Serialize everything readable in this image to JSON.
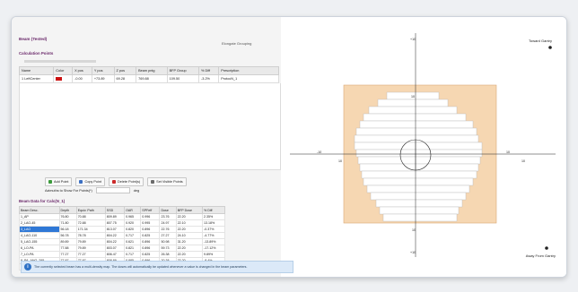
{
  "panel_title": "Beam (Tested)",
  "header_button": "Elongate Grouping",
  "calc_section": "Calculation Points",
  "points": {
    "columns": [
      "Name",
      "Color",
      "X pos",
      "Y pos",
      "Z pos",
      "Beam pntg",
      "BFP Group",
      "% Diff",
      "Prescription"
    ],
    "rows": [
      {
        "name": "1 LeftCenter",
        "color": "#cc1111",
        "x": "-0.00",
        "y": "+73.89",
        "z": "69.28",
        "beam": "769.88",
        "bfp": "109.50",
        "diff": "-3.2%",
        "prescription": "ProtocN_1"
      },
      {
        "name": "2 LeftPCA",
        "color": "#116611",
        "x": "0.73",
        "y": "+73.89",
        "z": "162.09",
        "beam": "769.78",
        "bfp": "108.60",
        "diff": "-2.9%",
        "prescription": "One for all prescriptions"
      }
    ]
  },
  "buttons": [
    "Add Point",
    "Copy Point",
    "Delete Point(s)",
    "Set Visible Points"
  ],
  "azimuth_label": "Azimuths to Show For Points(*)",
  "azimuth_unit": "deg",
  "beam_section": "Beam Data for Calc(N_1)",
  "beam": {
    "columns": [
      "Beam Desc.",
      "Depth",
      "Equiv. Path",
      "SSD",
      "OAR",
      "SPFeff",
      "Dose",
      "BFP Dose",
      "% Diff"
    ],
    "rows": [
      [
        "1_AP",
        "76.80",
        "70.88",
        "809.89",
        "0.965",
        "0.996",
        "23.76",
        "22.20",
        "2.35%"
      ],
      [
        "2_LAO-45",
        "71.80",
        "72.88",
        "807.75",
        "0.920",
        "0.995",
        "24.97",
        "22.10",
        "13.18%"
      ],
      [
        "3_LAO",
        "56.18",
        "171.34",
        "813.07",
        "0.820",
        "0.896",
        "22.76",
        "22.20",
        "-0.37%"
      ],
      [
        "4_LAO-110",
        "56.78",
        "78.78",
        "804.22",
        "0.717",
        "0.825",
        "27.27",
        "24.10",
        "-4.77%"
      ],
      [
        "5_LAO-155",
        "89.89",
        "79.89",
        "804.22",
        "0.621",
        "0.896",
        "50.98",
        "31.20",
        "-13.89%"
      ],
      [
        "6_LO-PA",
        "77.88",
        "79.89",
        "803.07",
        "0.821",
        "0.896",
        "59.73",
        "22.20",
        "-17.12%"
      ],
      [
        "7_LO-PA",
        "77.27",
        "77.27",
        "806.47",
        "0.717",
        "0.825",
        "26.38",
        "22.20",
        "9.89%"
      ],
      [
        "8_PA_ANG_295",
        "77.87",
        "77.87",
        "808.89",
        "0.885",
        "0.896",
        "20.38",
        "22.20",
        "-8.4%"
      ],
      [
        "9_PA_ANG_240",
        "77.87",
        "77.87",
        "808.89",
        "0.885",
        "0.896",
        "20.38",
        "22.20",
        "-8.4%"
      ]
    ]
  },
  "diagram": {
    "toward_label": "Toward Gantry",
    "away_label": "Away From Gantry",
    "axis_labels": {
      "top": "10",
      "bottom": "10",
      "left": "-10",
      "right": "10",
      "top_far": "+10",
      "bottom_far": "+10",
      "left_near": "10",
      "right_near": "10"
    }
  },
  "info_banner": "The currently selected beam has a multi-density map. The doses will automatically be updated whenever a value is changed in the beam parameters."
}
